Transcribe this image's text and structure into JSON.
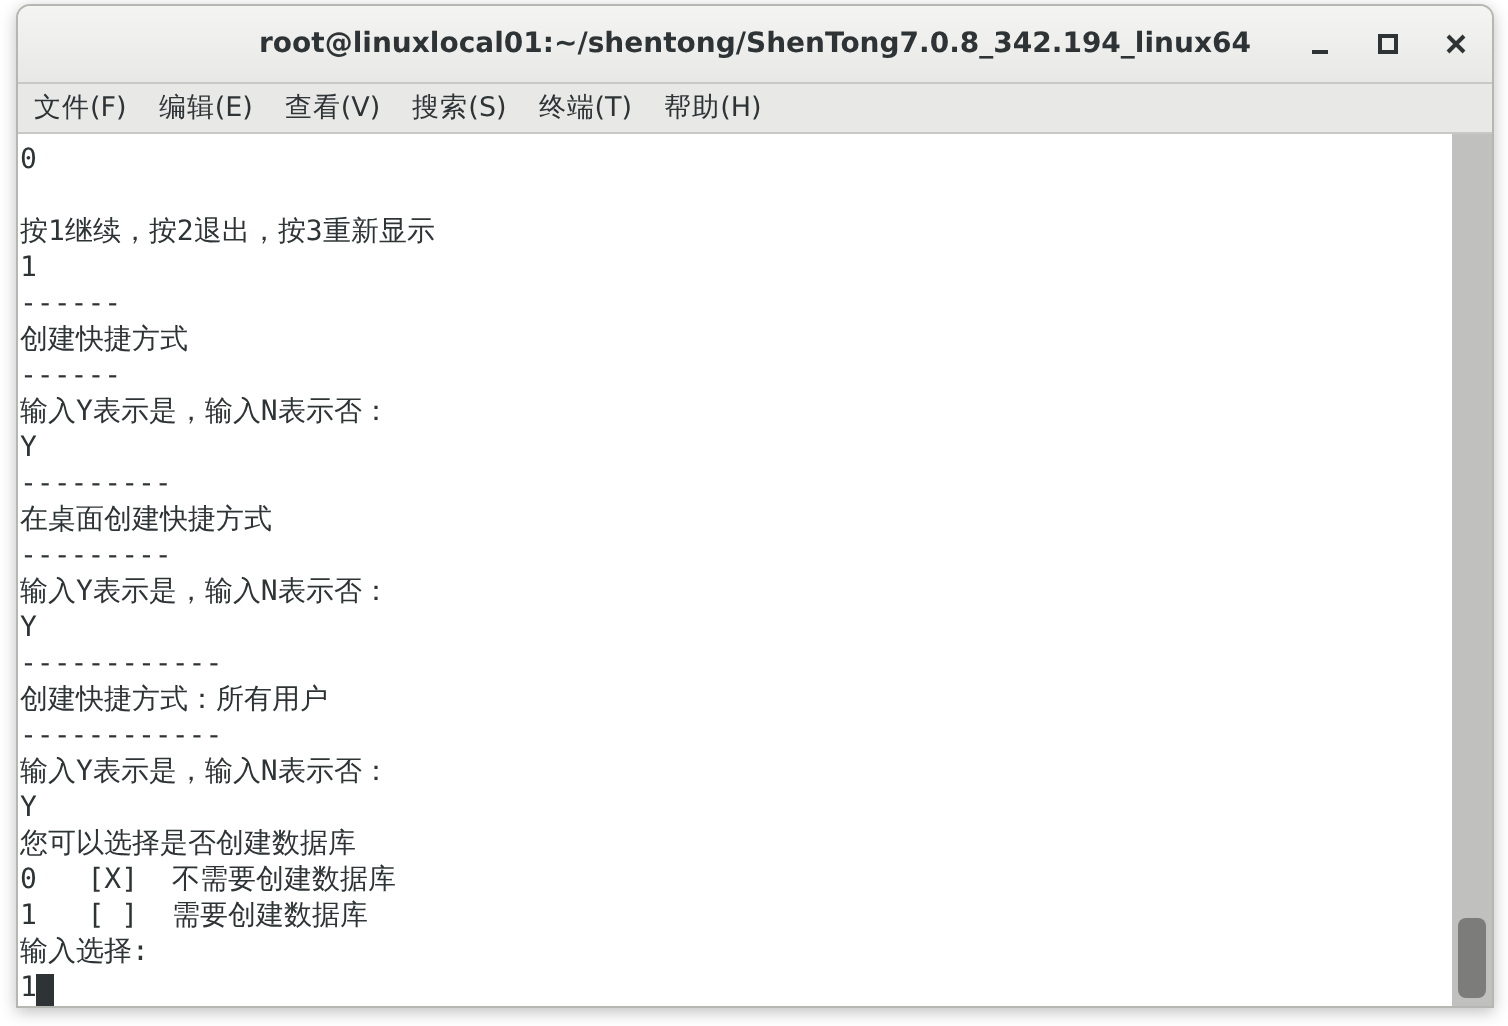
{
  "window": {
    "title": "root@linuxlocal01:~/shentong/ShenTong7.0.8_342.194_linux64"
  },
  "menu": [
    "文件(F)",
    "编辑(E)",
    "查看(V)",
    "搜索(S)",
    "终端(T)",
    "帮助(H)"
  ],
  "terminal": {
    "lines": [
      {
        "text": "0"
      },
      {
        "text": "按1继续，按2退出，按3重新显示",
        "blank_line_before": true
      },
      {
        "text": "1"
      },
      {
        "text": "------"
      },
      {
        "text": "创建快捷方式"
      },
      {
        "text": "------"
      },
      {
        "text": "输入Y表示是，输入N表示否："
      },
      {
        "text": "Y"
      },
      {
        "text": "---------"
      },
      {
        "text": "在桌面创建快捷方式"
      },
      {
        "text": "---------"
      },
      {
        "text": "输入Y表示是，输入N表示否："
      },
      {
        "text": "Y"
      },
      {
        "text": "------------"
      },
      {
        "text": "创建快捷方式：所有用户"
      },
      {
        "text": "------------"
      },
      {
        "text": "输入Y表示是，输入N表示否："
      },
      {
        "text": "Y"
      },
      {
        "text": "您可以选择是否创建数据库"
      },
      {
        "text": "0   [X]  不需要创建数据库"
      },
      {
        "text": "1   [ ]  需要创建数据库"
      },
      {
        "text": "输入选择:"
      },
      {
        "text": "1"
      }
    ]
  }
}
